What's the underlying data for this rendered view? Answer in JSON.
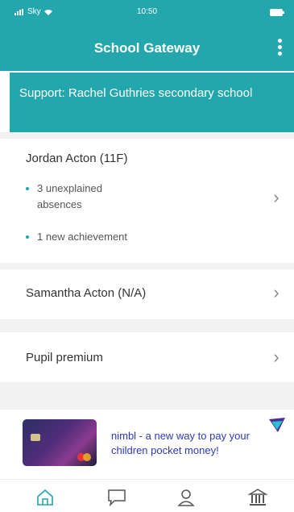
{
  "status_bar": {
    "carrier": "Sky",
    "time": "10:50"
  },
  "app_bar": {
    "title": "School Gateway"
  },
  "support": {
    "text": "Support: Rachel Guthries secondary school"
  },
  "students": [
    {
      "name": "Jordan Acton (11F)",
      "bullets": [
        "3 unexplained absences",
        "1 new achievement"
      ]
    },
    {
      "name": "Samantha Acton (N/A)",
      "bullets": []
    }
  ],
  "pupil_premium": {
    "label": "Pupil premium"
  },
  "banner": {
    "text": "nimbl - a new way to pay your children pocket money!"
  },
  "nav": {
    "items": [
      "home-icon",
      "chat-icon",
      "profile-icon",
      "bank-icon"
    ]
  },
  "colors": {
    "accent": "#23a7ad",
    "banner_text": "#2d3bb3"
  }
}
